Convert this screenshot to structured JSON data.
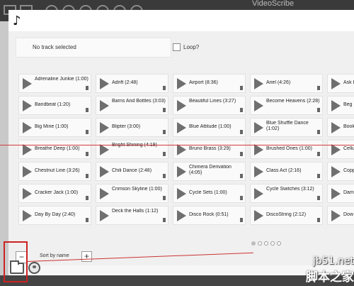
{
  "app": {
    "title": "VideoScribe"
  },
  "dialog": {
    "music_icon": "♪",
    "track_status": "No track selected",
    "loop_label": "Loop?",
    "loop_checked": false
  },
  "tracks": [
    [
      "Adrenaline Junkie (1:00)",
      "Adrift (2:48)",
      "Airport (8:36)",
      "Ariel (4:26)",
      "Ask I"
    ],
    [
      "Bandbeat (1:20)",
      "Barns And Bottles (3:03)",
      "Beautiful Lines (3:27)",
      "Become Heavens (2:28)",
      "Beg"
    ],
    [
      "Big Mine (1:00)",
      "Blipter (3:00)",
      "Blue Attitude (1:00)",
      "Blue Shuffle Dance (1:02)",
      "Book"
    ],
    [
      "Breathe Deep (1:00)",
      "Bright Shining (4:19)",
      "Bruno Brass (3:29)",
      "Brushed Ones (1:00)",
      "Cellu"
    ],
    [
      "Chestnut Line (3:26)",
      "Chili Dance (2:48)",
      "Chimera Derivation (4:05)",
      "Class Act (2:16)",
      "Copp"
    ],
    [
      "Cracker Jack (1:00)",
      "Crimson Skyline (1:00)",
      "Cycle Sets (1:00)",
      "Cycle Switches (3:12)",
      "Dam"
    ],
    [
      "Day By Day (2:40)",
      "Deck the Halls (1:12)",
      "Disco Rock (0:51)",
      "DiscoString (2:12)",
      "Dow"
    ]
  ],
  "pagination": {
    "pages": 5,
    "current": 1
  },
  "controls": {
    "minus": "−",
    "sort_label": "Sort by name",
    "plus": "+"
  },
  "watermark": {
    "site": "jb51.net",
    "cn": "脚本之家"
  },
  "colors": {
    "highlight": "#cc2222",
    "play_icon": "#6f6f6f",
    "tile_bg": "#fafafa"
  }
}
